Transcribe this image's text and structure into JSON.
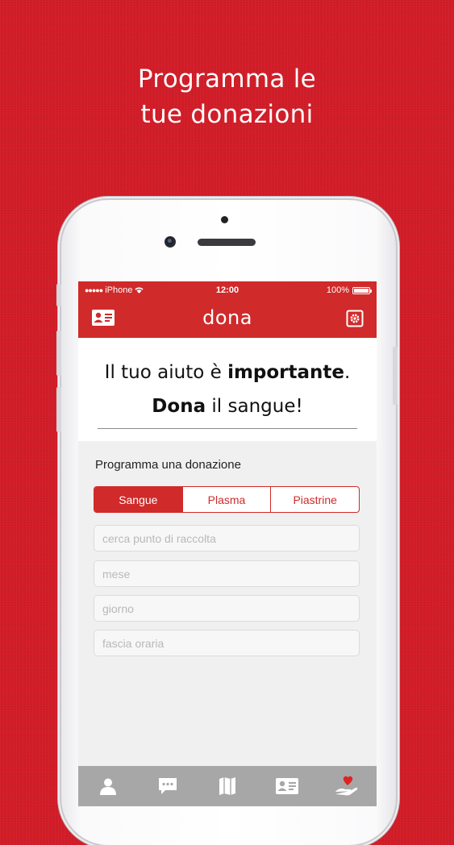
{
  "promo": {
    "line1": "Programma le",
    "line2": "tue donazioni"
  },
  "statusbar": {
    "carrier": "iPhone",
    "time": "12:00",
    "battery": "100%",
    "signal_dots": "●●●●●"
  },
  "navbar": {
    "title": "dona",
    "left_icon": "id-card-icon",
    "right_icon": "settings-icon"
  },
  "hero": {
    "line1_prefix": "Il tuo aiuto è ",
    "line1_bold": "importante",
    "line1_suffix": ".",
    "line2_bold": "Dona",
    "line2_suffix": " il sangue!"
  },
  "form": {
    "title": "Programma una donazione",
    "segments": [
      "Sangue",
      "Plasma",
      "Piastrine"
    ],
    "active_segment": "Sangue",
    "fields": [
      {
        "placeholder": "cerca punto di raccolta"
      },
      {
        "placeholder": "mese"
      },
      {
        "placeholder": "giorno"
      },
      {
        "placeholder": "fascia oraria"
      }
    ]
  },
  "tabbar": {
    "items": [
      "profile-icon",
      "chat-icon",
      "map-icon",
      "card-icon",
      "donate-heart-icon"
    ]
  },
  "colors": {
    "brand": "#d02a2a",
    "background": "#d21d28",
    "tabbar": "#a7a7a7"
  }
}
